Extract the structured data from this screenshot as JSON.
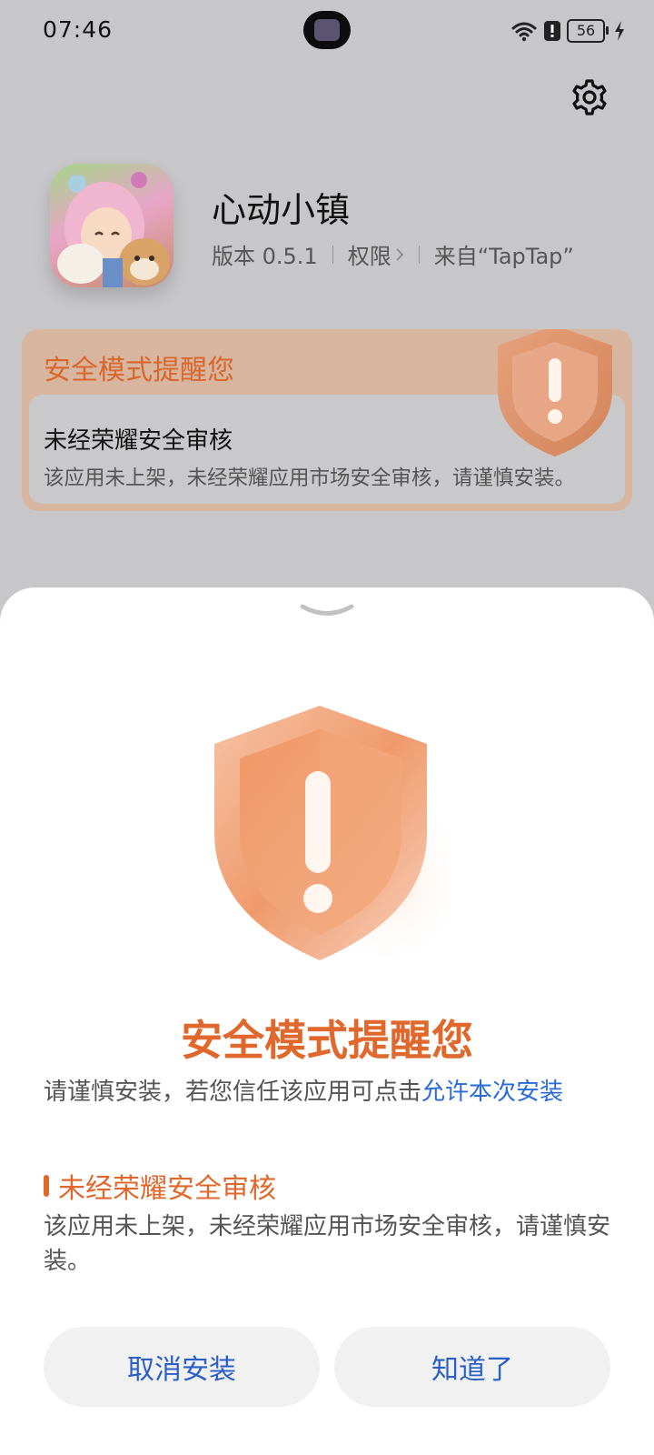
{
  "status_bar": {
    "time": "07:46",
    "battery": "56"
  },
  "app": {
    "name": "心动小镇",
    "version": "版本 0.5.1",
    "permissions": "权限",
    "source": "来自“TapTap”"
  },
  "warning_card": {
    "title": "安全模式提醒您",
    "heading": "未经荣耀安全审核",
    "description": "该应用未上架，未经荣耀应用市场安全审核，请谨慎安装。"
  },
  "sheet": {
    "title": "安全模式提醒您",
    "subtitle": "请谨慎安装，若您信任该应用可点击",
    "allow_link": "允许本次安装",
    "section_title": "未经荣耀安全审核",
    "section_desc": "该应用未上架，未经荣耀应用市场安全审核，请谨慎安装。",
    "cancel_label": "取消安装",
    "ok_label": "知道了"
  },
  "colors": {
    "accent_orange": "#e0682d",
    "link_blue": "#2a6bd8"
  },
  "icons": [
    "wifi-icon",
    "alert-icon",
    "battery-icon",
    "charging-icon",
    "gear-icon",
    "chevron-right-icon",
    "shield-alert-icon",
    "chevron-down-icon"
  ]
}
